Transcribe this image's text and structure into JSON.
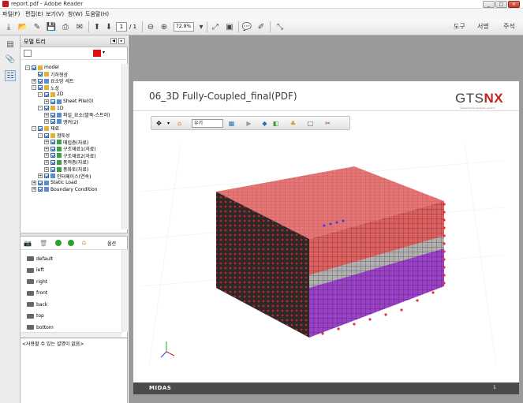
{
  "window": {
    "title": "report.pdf - Adobe Reader",
    "minimize": "_",
    "maximize": "□",
    "close": "×"
  },
  "menu": {
    "items": [
      "파일(F)",
      "편집(E)",
      "보기(V)",
      "창(W)",
      "도움말(H)"
    ]
  },
  "toolbar": {
    "page_current": "1",
    "page_total": "/ 1",
    "zoom": "72.9%",
    "tools_label": "도구",
    "sign_label": "서명",
    "comment_label": "주석"
  },
  "model_panel": {
    "title": "모델 트리",
    "tree": [
      {
        "label": "model",
        "indent": 0,
        "expand": "-",
        "icon": "folder-icon"
      },
      {
        "label": "기하형상",
        "indent": 1,
        "expand": "",
        "icon": "folder-icon"
      },
      {
        "label": "요소망 세트",
        "indent": 1,
        "expand": "+",
        "icon": "mesh-icon"
      },
      {
        "label": "노상",
        "indent": 1,
        "expand": "-",
        "icon": "folder-icon"
      },
      {
        "label": "2D",
        "indent": 2,
        "expand": "-",
        "icon": "folder-icon"
      },
      {
        "label": "Sheet Pile(0)",
        "indent": 3,
        "expand": "+",
        "icon": "sheet-icon"
      },
      {
        "label": "1D",
        "indent": 2,
        "expand": "-",
        "icon": "folder-icon"
      },
      {
        "label": "파일_요소(말뚝-스트러)",
        "indent": 3,
        "expand": "+",
        "icon": "pile-icon"
      },
      {
        "label": "앵커(2)",
        "indent": 3,
        "expand": "+",
        "icon": "anchor-icon"
      },
      {
        "label": "재료",
        "indent": 1,
        "expand": "-",
        "icon": "folder-icon"
      },
      {
        "label": "점토성",
        "indent": 2,
        "expand": "-",
        "icon": "folder-icon"
      },
      {
        "label": "매립층(자료)",
        "indent": 3,
        "expand": "+",
        "icon": "material-icon"
      },
      {
        "label": "구조재료1(자료)",
        "indent": 3,
        "expand": "+",
        "icon": "material-icon"
      },
      {
        "label": "구조재료2(자료)",
        "indent": 3,
        "expand": "+",
        "icon": "material-icon"
      },
      {
        "label": "풍적층(자료)",
        "indent": 3,
        "expand": "+",
        "icon": "material-icon"
      },
      {
        "label": "풍화토(자료)",
        "indent": 3,
        "expand": "+",
        "icon": "material-icon"
      },
      {
        "label": "인터페이스(연속)",
        "indent": 2,
        "expand": "+",
        "icon": "interface-icon"
      },
      {
        "label": "Static Load",
        "indent": 1,
        "expand": "+",
        "icon": "load-icon"
      },
      {
        "label": "Boundary Condition",
        "indent": 1,
        "expand": "+",
        "icon": "boundary-icon"
      }
    ],
    "view_tools_label": "옵션",
    "views": [
      "default",
      "left",
      "right",
      "front",
      "back",
      "top",
      "bottom"
    ],
    "description": "<사용할 수 있는 설명이 없음>"
  },
  "document": {
    "slide_title": "06_3D Fully-Coupled_final(PDF)",
    "logo_gts": "GTS",
    "logo_nx": "NX",
    "logo_sub": "Geotechnical analysis system",
    "view_dropdown": "우기",
    "footer_brand": "MIDAS",
    "page_number": "1"
  },
  "colors": {
    "top_face": "#e67575",
    "side_top_layer": "#e06060",
    "grey_layer": "#b0b0b0",
    "purple_layer": "#9b40c8",
    "mesh_line": "#2a2a2a",
    "load_marker": "#e83030",
    "viewer_bg": "#9a9a9a"
  }
}
